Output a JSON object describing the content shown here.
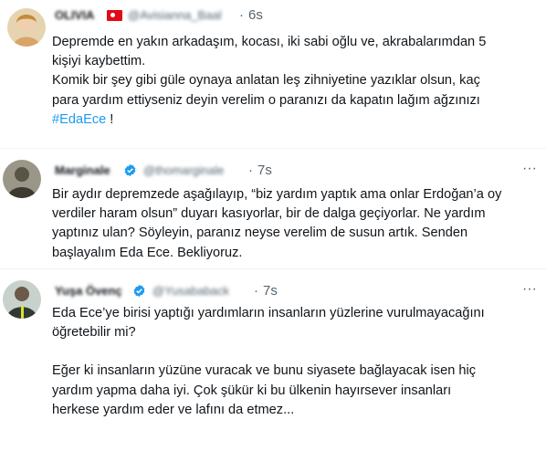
{
  "tweets": [
    {
      "name": "OLIVIA",
      "handle": "@Avisianna_Baal",
      "time": "6s",
      "dot": "·",
      "more": "···",
      "lines": [
        "Depremde en yakın arkadaşım, kocası, iki sabi oğlu ve, akrabalarımdan 5",
        "kişiyi kaybettim.",
        "Komik bir şey gibi güle oynaya anlatan leş zihniyetine yazıklar olsun, kaç",
        "para yardım ettiyseniz deyin verelim o paranızı da kapatın lağım ağzınızı"
      ],
      "hashtag": "#EdaEce",
      "hashtag_suffix": " !"
    },
    {
      "name": "Marginale",
      "handle": "@thomarginale",
      "time": "7s",
      "dot": "·",
      "more": "···",
      "lines": [
        "Bir aydır depremzede aşağılayıp, “biz yardım yaptık ama onlar Erdoğan’a oy",
        "verdiler haram olsun” duyarı kasıyorlar, bir de dalga geçiyorlar. Ne yardım",
        "yaptınız ulan? Söyleyin, paranız neyse verelim de susun artık. Senden",
        "başlayalım Eda Ece. Bekliyoruz."
      ]
    },
    {
      "name": "Yuşa Övenç",
      "handle": "@Yusababack",
      "time": "7s",
      "dot": "·",
      "more": "···",
      "lines_a": [
        "Eda Ece’ye birisi yaptığı yardımların insanların yüzlerine vurulmayacağını",
        "öğretebilir mi?"
      ],
      "lines_b": [
        "Eğer ki insanların yüzüne vuracak ve bunu siyasete bağlayacak isen hiç",
        "yardım yapma daha iyi. Çok şükür ki bu ülkenin hayırsever insanları",
        "herkese yardım eder ve lafını da etmez..."
      ]
    }
  ],
  "colors": {
    "link": "#1d9bf0",
    "verified": "#1d9bf0",
    "muted": "#536471"
  }
}
